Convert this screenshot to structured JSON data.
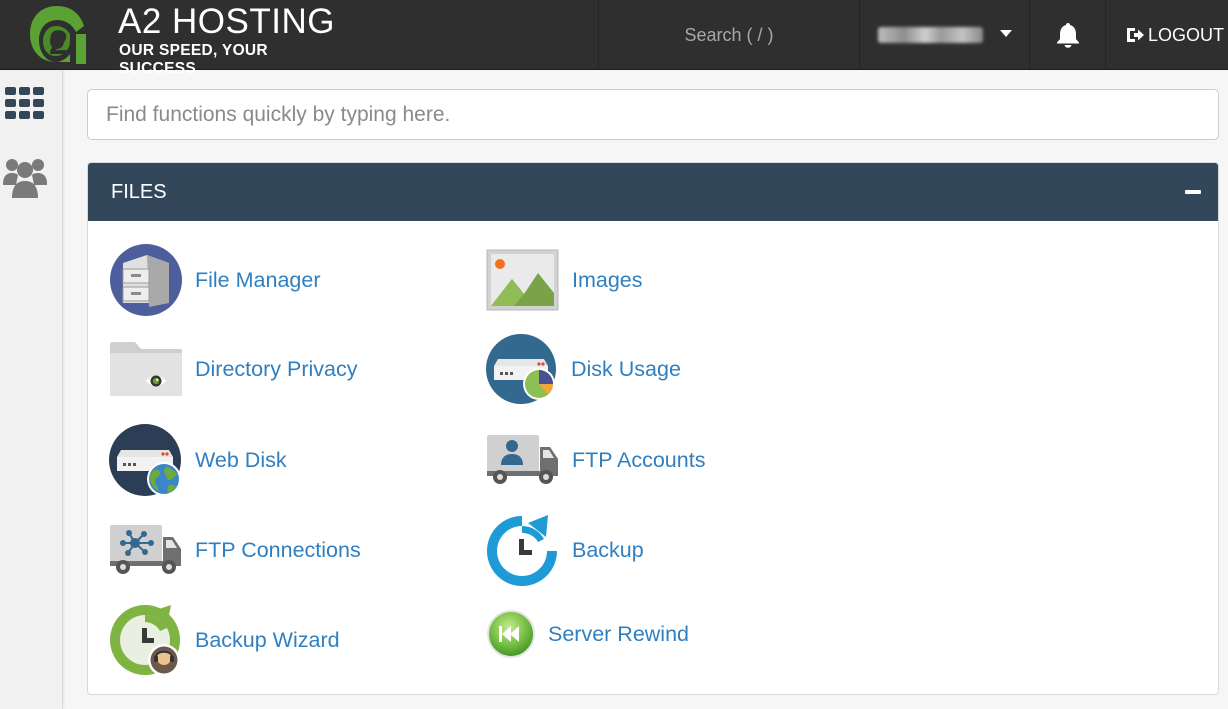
{
  "header": {
    "brand": "A2 HOSTING",
    "tagline": "OUR SPEED, YOUR SUCCESS",
    "search_label": "Search ( / )",
    "logout_label": "LOGOUT"
  },
  "quick_search": {
    "placeholder": "Find functions quickly by typing here."
  },
  "files_panel": {
    "title": "FILES",
    "items": [
      {
        "label": "File Manager",
        "icon": "file-cabinet-icon"
      },
      {
        "label": "Images",
        "icon": "image-icon"
      },
      {
        "label": "Directory Privacy",
        "icon": "folder-eye-icon"
      },
      {
        "label": "Disk Usage",
        "icon": "disk-pie-icon"
      },
      {
        "label": "Web Disk",
        "icon": "server-globe-icon"
      },
      {
        "label": "FTP Accounts",
        "icon": "truck-user-icon"
      },
      {
        "label": "FTP Connections",
        "icon": "truck-network-icon"
      },
      {
        "label": "Backup",
        "icon": "backup-clock-icon"
      },
      {
        "label": "Backup Wizard",
        "icon": "backup-wizard-icon"
      },
      {
        "label": "Server Rewind",
        "icon": "rewind-icon"
      }
    ]
  },
  "colors": {
    "header_bg": "#2f2f2f",
    "panel_head_bg": "#33475b",
    "link": "#2f7fc1",
    "brand_green": "#5ba133"
  }
}
